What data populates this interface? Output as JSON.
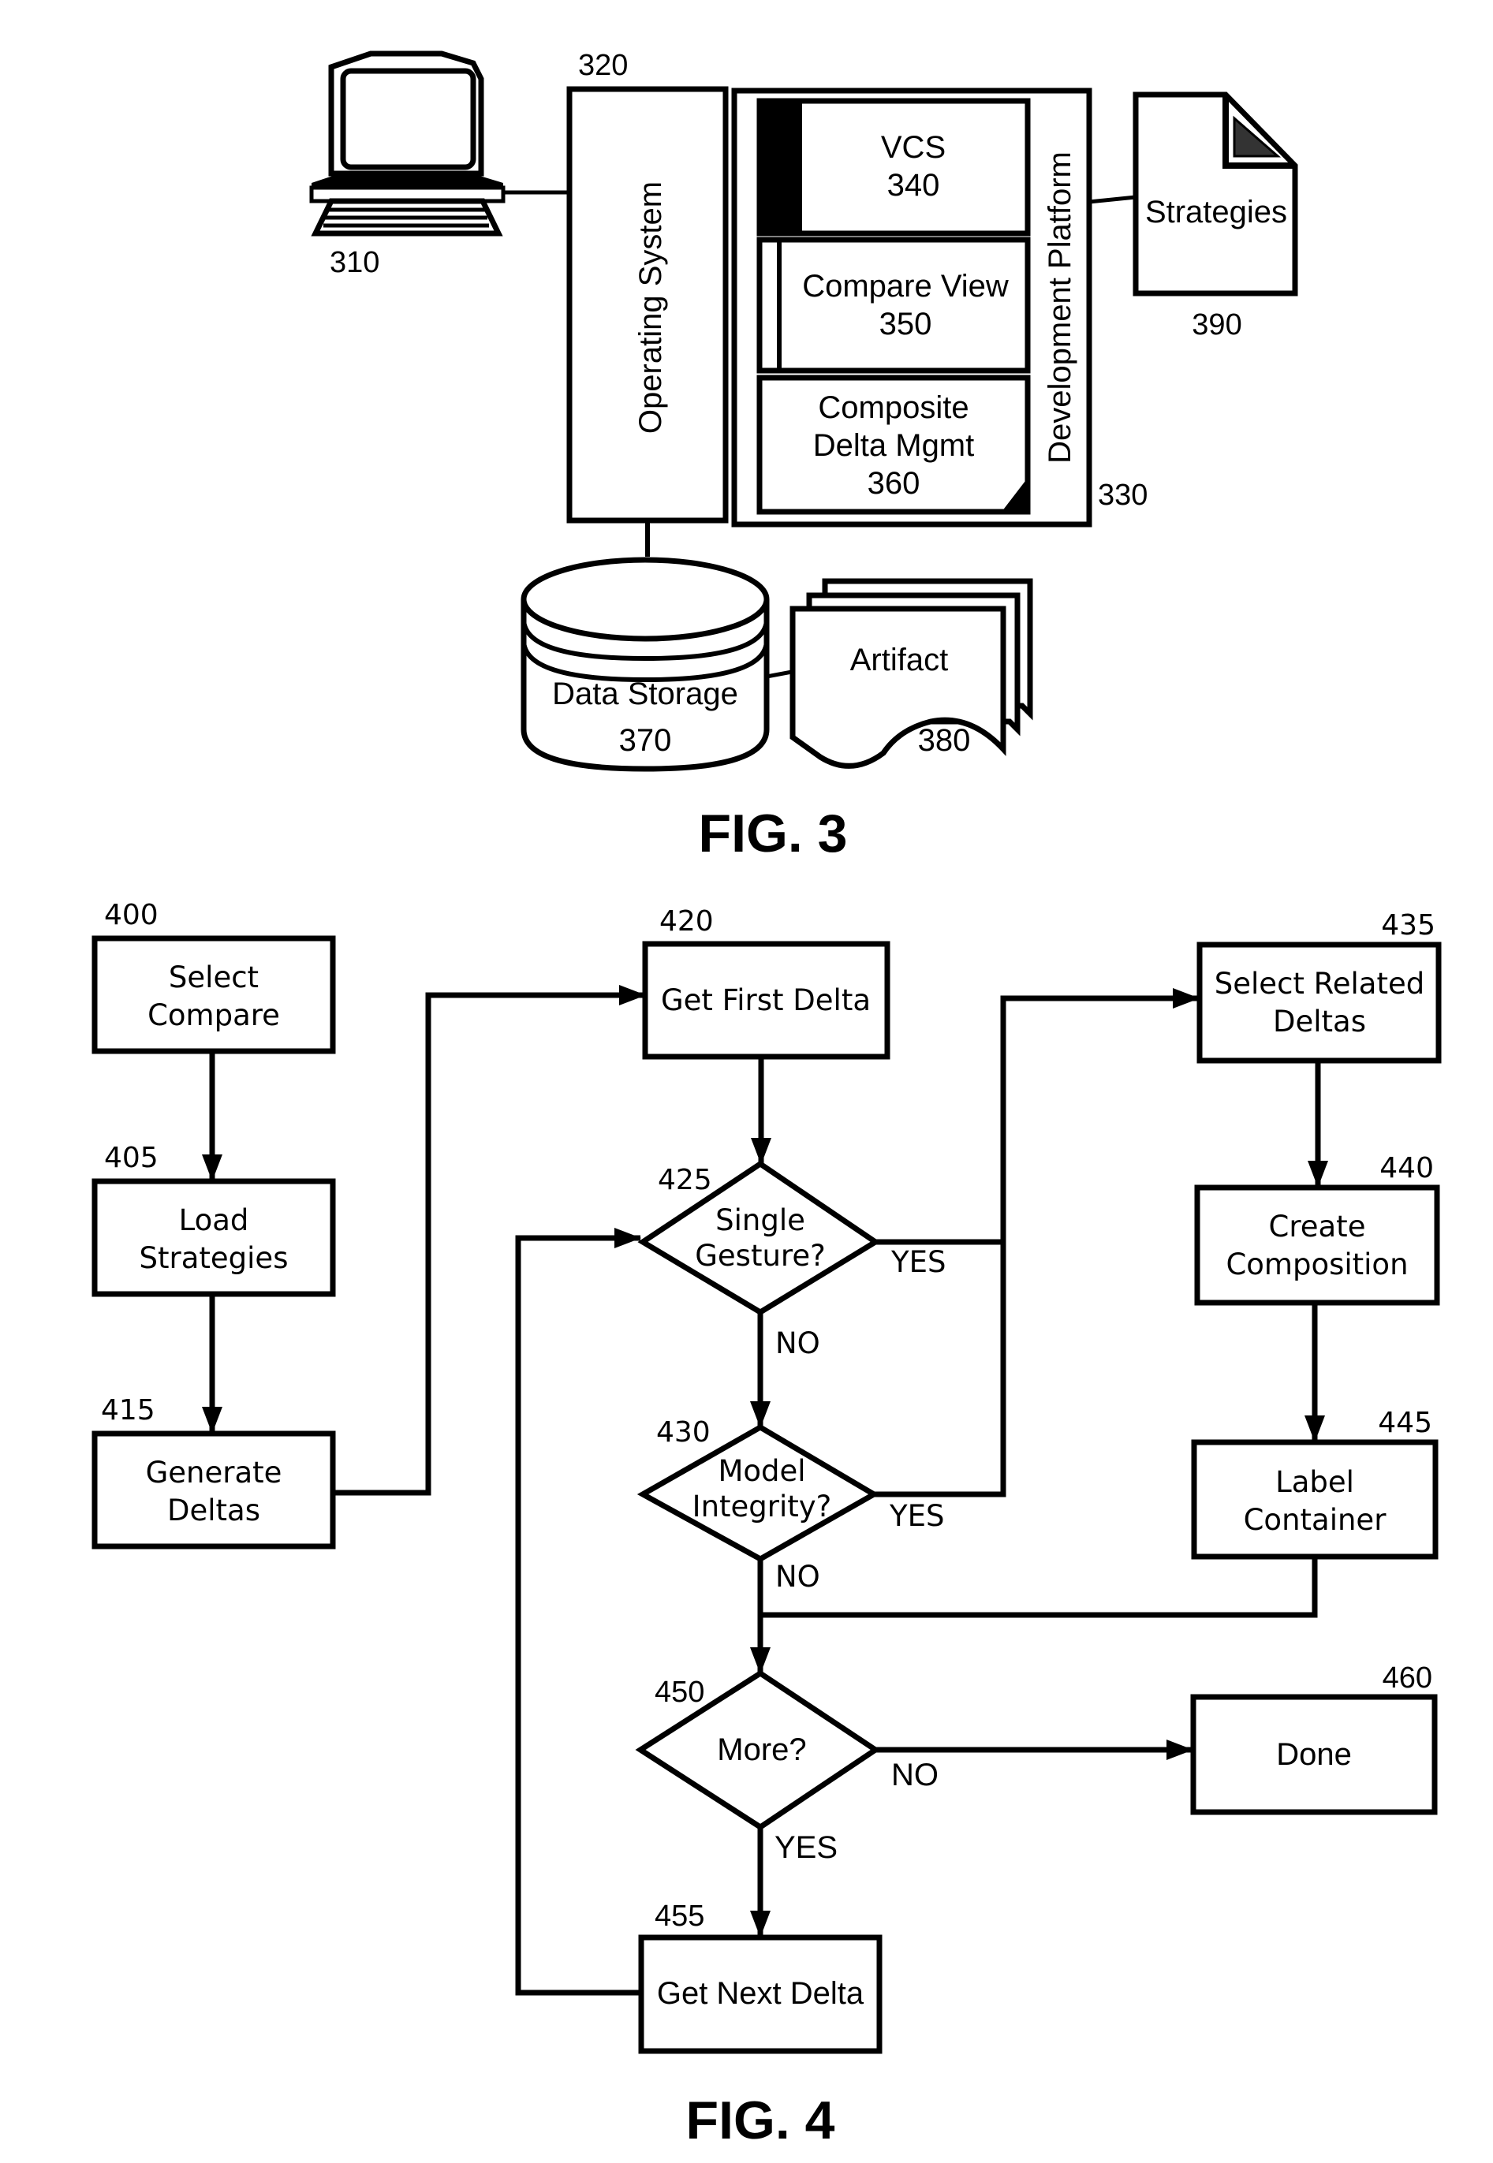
{
  "fig3": {
    "caption": "FIG. 3",
    "computer": {
      "ref": "310",
      "icon": "computer-terminal-icon"
    },
    "os": {
      "ref": "320",
      "label": "Operating System"
    },
    "platform": {
      "ref": "330",
      "label": "Development Platform"
    },
    "vcs": {
      "label": "VCS",
      "ref": "340"
    },
    "compare_view": {
      "label": "Compare View",
      "ref": "350"
    },
    "composite": {
      "line1": "Composite",
      "line2": "Delta Mgmt",
      "ref": "360"
    },
    "storage": {
      "label": "Data Storage",
      "ref": "370",
      "icon": "database-cylinder-icon"
    },
    "artifact": {
      "label": "Artifact",
      "ref": "380",
      "icon": "stacked-documents-icon"
    },
    "strategies": {
      "label": "Strategies",
      "ref": "390",
      "icon": "document-icon"
    }
  },
  "fig4": {
    "caption": "FIG. 4",
    "steps": {
      "s400": {
        "ref": "400",
        "line1": "Select",
        "line2": "Compare"
      },
      "s405": {
        "ref": "405",
        "line1": "Load",
        "line2": "Strategies"
      },
      "s415": {
        "ref": "415",
        "line1": "Generate",
        "line2": "Deltas"
      },
      "s420": {
        "ref": "420",
        "line1": "Get First Delta"
      },
      "s425": {
        "ref": "425",
        "line1": "Single",
        "line2": "Gesture?"
      },
      "s430": {
        "ref": "430",
        "line1": "Model",
        "line2": "Integrity?"
      },
      "s435": {
        "ref": "435",
        "line1": "Select Related",
        "line2": "Deltas"
      },
      "s440": {
        "ref": "440",
        "line1": "Create",
        "line2": "Composition"
      },
      "s445": {
        "ref": "445",
        "line1": "Label",
        "line2": "Container"
      },
      "s450": {
        "ref": "450",
        "line1": "More?"
      },
      "s455": {
        "ref": "455",
        "line1": "Get Next Delta"
      },
      "s460": {
        "ref": "460",
        "line1": "Done"
      }
    },
    "edge_labels": {
      "yes_425": "YES",
      "no_425": "NO",
      "yes_430": "YES",
      "no_430": "NO",
      "no_450": "NO",
      "yes_450": "YES"
    }
  }
}
